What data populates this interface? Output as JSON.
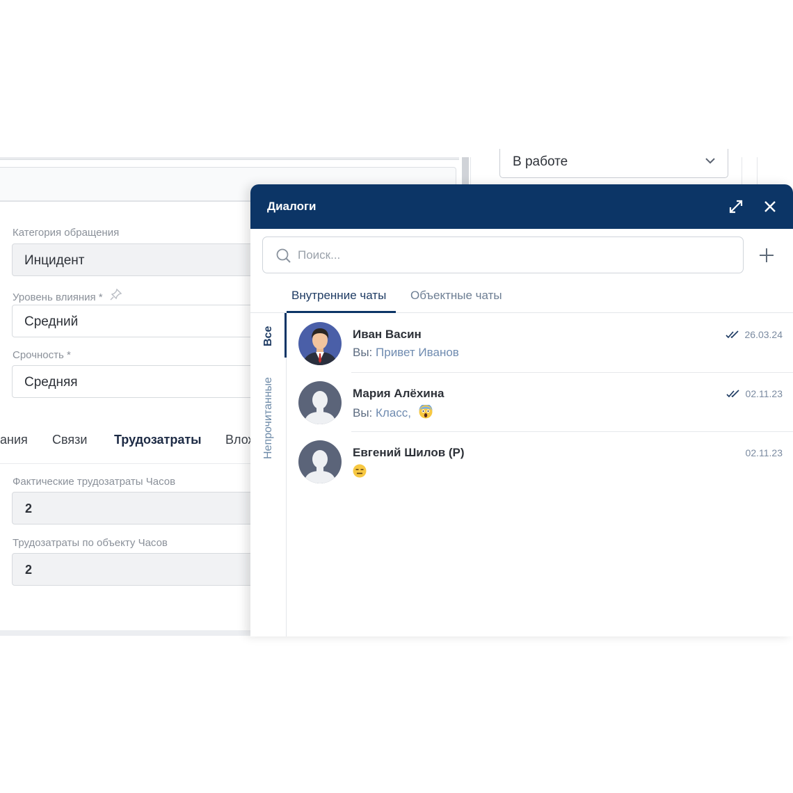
{
  "form": {
    "category_label": "Категория обращения",
    "category_value": "Инцидент",
    "impact_label": "Уровень влияния *",
    "impact_value": "Средний",
    "urgency_label": "Срочность *",
    "urgency_value": "Средняя",
    "tabs": [
      "ания",
      "Связи",
      "Трудозатраты",
      "Влож"
    ],
    "active_tab": "Трудозатраты",
    "actual_hours_label": "Фактические трудозатраты Часов",
    "actual_hours_value": "2",
    "object_hours_label": "Трудозатраты по объекту Часов",
    "object_hours_value": "2"
  },
  "status_select": {
    "value": "В работе"
  },
  "dialog": {
    "title": "Диалоги",
    "search_placeholder": "Поиск...",
    "tabs": [
      {
        "label": "Внутренние чаты",
        "active": true
      },
      {
        "label": "Объектные чаты",
        "active": false
      }
    ],
    "side_tabs": [
      {
        "label": "Все",
        "active": true
      },
      {
        "label": "Непрочитанные",
        "active": false
      }
    ],
    "chats": [
      {
        "name": "Иван Васин",
        "prefix": "Вы:",
        "message": "Привет Иванов",
        "emoji": "",
        "date": "26.03.24",
        "read": true,
        "avatar": "man-avatar"
      },
      {
        "name": "Мария Алёхина",
        "prefix": "Вы:",
        "message": "Класс,",
        "emoji": "screaming-face",
        "date": "02.11.23",
        "read": true,
        "avatar": "silhouette-avatar"
      },
      {
        "name": "Евгений Шилов (Р)",
        "prefix": "",
        "message": "",
        "emoji": "expressionless-face",
        "date": "02.11.23",
        "read": false,
        "avatar": "silhouette-avatar"
      }
    ]
  },
  "colors": {
    "header": "#0c3566",
    "accent_text": "#1e3b63",
    "muted_text": "#6f8bb0"
  }
}
